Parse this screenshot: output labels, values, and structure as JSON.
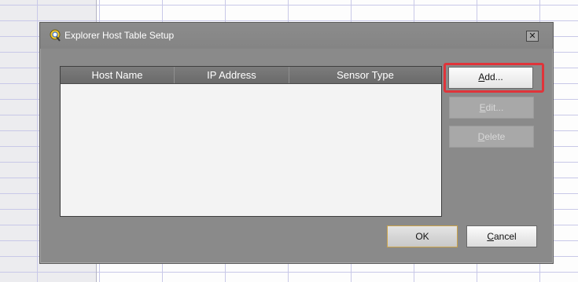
{
  "dialog": {
    "title": "Explorer Host Table Setup",
    "close_glyph": "✕",
    "icon": "magnifier-host-icon"
  },
  "table": {
    "columns": [
      "Host Name",
      "IP Address",
      "Sensor Type"
    ],
    "rows": []
  },
  "buttons": {
    "add": {
      "label": "Add...",
      "accel": "A",
      "rest": "dd...",
      "enabled": true,
      "highlighted": true
    },
    "edit": {
      "label": "Edit...",
      "accel": "E",
      "rest": "dit...",
      "enabled": false
    },
    "delete": {
      "label": "Delete",
      "accel": "D",
      "rest": "elete",
      "enabled": false
    },
    "ok": {
      "label": "OK"
    },
    "cancel": {
      "label": "Cancel",
      "accel": "C",
      "rest": "ancel"
    }
  },
  "colors": {
    "dialog_bg": "#8a8a8a",
    "highlight": "#e0343a",
    "ok_border": "#c9a24a"
  }
}
